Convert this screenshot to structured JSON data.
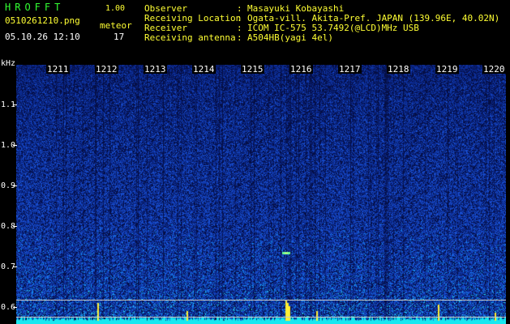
{
  "header": {
    "brand": "HROFFT",
    "version": "1.00",
    "filename": "0510261210.png",
    "datetime": "05.10.26 12:10",
    "event_label": "meteor",
    "event_count": "17"
  },
  "info": [
    {
      "label": "Observer",
      "value": "Masayuki Kobayashi"
    },
    {
      "label": "Receiving Location",
      "value": "Ogata-vill. Akita-Pref. JAPAN (139.96E, 40.02N)"
    },
    {
      "label": "Receiver",
      "value": "ICOM IC-575 53.7492(@LCD)MHz USB"
    },
    {
      "label": "Receiving antenna",
      "value": "A504HB(yagi 4el)"
    }
  ],
  "axis": {
    "unit": "kHz",
    "y_ticks": [
      "1.1",
      "1.0",
      "0.9",
      "0.8",
      "0.7",
      "0.6"
    ],
    "time_ticks": [
      "1211",
      "1212",
      "1213",
      "1214",
      "1215",
      "1216",
      "1217",
      "1218",
      "1219",
      "1220"
    ]
  },
  "colors": {
    "background": "#000000",
    "spectrogram_base": "#0d2a8a",
    "header_yellow": "#ffff33",
    "brand_green": "#33ff33"
  }
}
